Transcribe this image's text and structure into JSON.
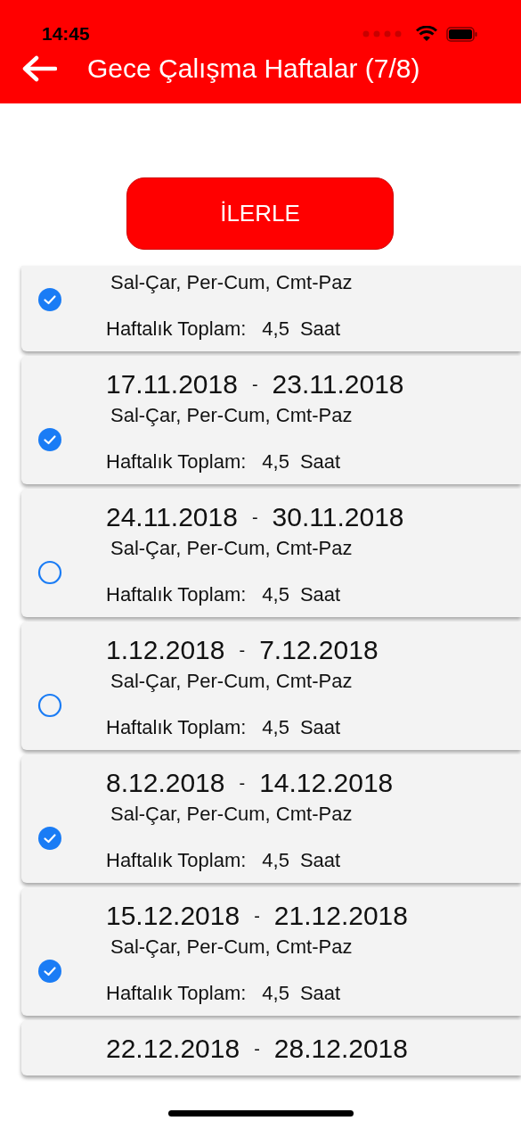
{
  "status_bar": {
    "time": "14:45"
  },
  "header": {
    "title": "Gece Çalışma Haftalar (7/8)"
  },
  "proceed_button": "İLERLE",
  "weeks": [
    {
      "selected": true,
      "days": "Sal-Çar, Per-Cum, Cmt-Paz",
      "total_label": "Haftalık Toplam:",
      "total_value": "4,5",
      "unit": "Saat"
    },
    {
      "selected": true,
      "start": "17.11.2018",
      "separator": "-",
      "end": "23.11.2018",
      "days": "Sal-Çar, Per-Cum, Cmt-Paz",
      "total_label": "Haftalık Toplam:",
      "total_value": "4,5",
      "unit": "Saat"
    },
    {
      "selected": false,
      "start": "24.11.2018",
      "separator": "-",
      "end": "30.11.2018",
      "days": "Sal-Çar, Per-Cum, Cmt-Paz",
      "total_label": "Haftalık Toplam:",
      "total_value": "4,5",
      "unit": "Saat"
    },
    {
      "selected": false,
      "start": "1.12.2018",
      "separator": "-",
      "end": "7.12.2018",
      "days": "Sal-Çar, Per-Cum, Cmt-Paz",
      "total_label": "Haftalık Toplam:",
      "total_value": "4,5",
      "unit": "Saat"
    },
    {
      "selected": true,
      "start": "8.12.2018",
      "separator": "-",
      "end": "14.12.2018",
      "days": "Sal-Çar, Per-Cum, Cmt-Paz",
      "total_label": "Haftalık Toplam:",
      "total_value": "4,5",
      "unit": "Saat"
    },
    {
      "selected": true,
      "start": "15.12.2018",
      "separator": "-",
      "end": "21.12.2018",
      "days": "Sal-Çar, Per-Cum, Cmt-Paz",
      "total_label": "Haftalık Toplam:",
      "total_value": "4,5",
      "unit": "Saat"
    },
    {
      "start": "22.12.2018",
      "separator": "-",
      "end": "28.12.2018"
    }
  ]
}
